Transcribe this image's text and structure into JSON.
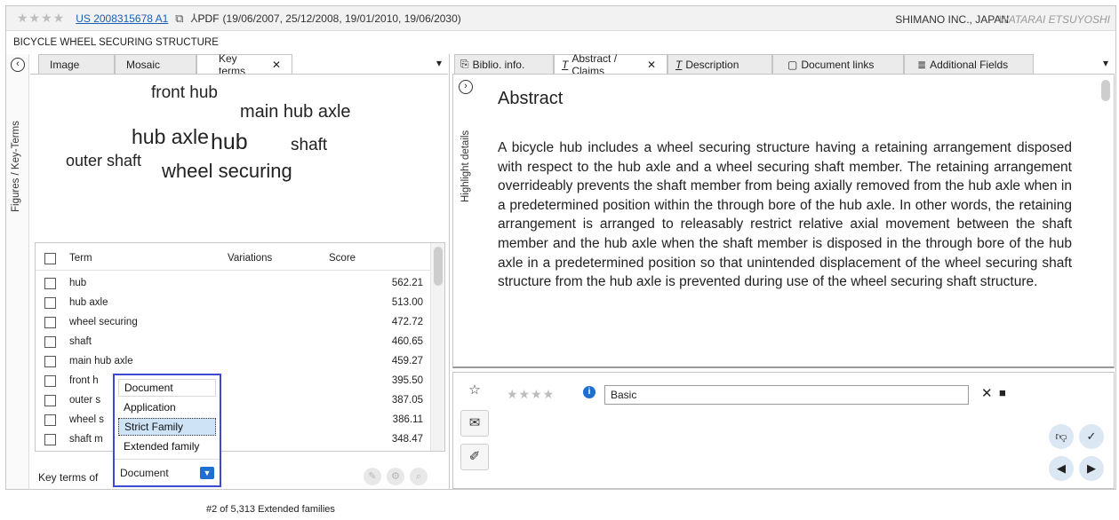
{
  "header": {
    "stars": "★★★★",
    "publication_number": "US 2008315678 A1",
    "pdf_label": "PDF",
    "dates": "(19/06/2007, 25/12/2008, 19/01/2010, 19/06/2030)",
    "applicant": "SHIMANO INC., JAPAN",
    "inventor": "WATARAI ETSUYOSHI",
    "title": "BICYCLE WHEEL SECURING STRUCTURE"
  },
  "left": {
    "side_label": "Figures / Key-Terms",
    "tabs": [
      {
        "label": "Image"
      },
      {
        "label": "Mosaic"
      },
      {
        "label": "Key terms"
      }
    ],
    "cloud": [
      "front hub",
      "main hub axle",
      "hub axle",
      "hub",
      "shaft",
      "outer shaft",
      "wheel securing"
    ],
    "table": {
      "headers": [
        "Term",
        "Variations",
        "Score"
      ],
      "rows": [
        {
          "term": "hub",
          "score": "562.21"
        },
        {
          "term": "hub axle",
          "score": "513.00"
        },
        {
          "term": "wheel securing",
          "score": "472.72"
        },
        {
          "term": "shaft",
          "score": "460.65"
        },
        {
          "term": "main hub axle",
          "score": "459.27"
        },
        {
          "term": "front h",
          "score": "395.50"
        },
        {
          "term": "outer s",
          "score": "387.05"
        },
        {
          "term": "wheel s",
          "score": "386.11"
        },
        {
          "term": "shaft m",
          "score": "348.47"
        }
      ]
    },
    "dropdown_options": [
      "Document",
      "Application",
      "Strict Family",
      "Extended family"
    ],
    "key_terms_of_label": "Key terms of",
    "selected_value": "Document"
  },
  "right": {
    "tabs": [
      {
        "label": "Biblio. info."
      },
      {
        "label": "Abstract / Claims"
      },
      {
        "label": "Description"
      },
      {
        "label": "Document links"
      },
      {
        "label": "Additional Fields"
      }
    ],
    "side_label": "Highlight details",
    "abstract_title": "Abstract",
    "abstract_text": "A bicycle hub includes a wheel securing structure having a retaining arrangement disposed with respect to the hub axle and a wheel securing shaft member. The retaining arrangement overrideably prevents the shaft member from being axially removed from the hub axle when in a predetermined position within the through bore of the hub axle. In other words, the retaining arrangement is arranged to releasably restrict relative axial movement between the shaft member and the hub axle when the shaft member is disposed in the through bore of the hub axle in a predetermined position so that unintended displacement of the wheel securing shaft structure from the hub axle is prevented during use of the wheel securing shaft structure.",
    "note": {
      "stars": "★★★★",
      "input_value": "Basic"
    }
  },
  "footer": {
    "status": "#2 of 5,313 Extended families"
  },
  "colors": {
    "accent": "#3c4bd1",
    "link": "#1a5fb4",
    "select_arrow": "#1f6fd1"
  }
}
